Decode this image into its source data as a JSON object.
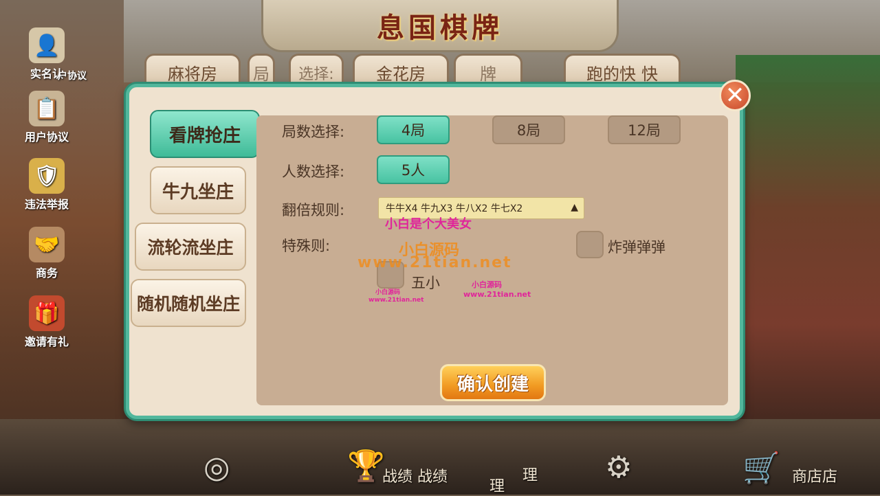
{
  "app": {
    "title": "息国棋牌"
  },
  "room_tabs": [
    "麻将房",
    "局",
    "选择:",
    "金花房",
    "牌",
    "跑的快",
    "快"
  ],
  "sidebar": [
    {
      "label": "实名认",
      "icon": "id-card-icon"
    },
    {
      "label": "户协议",
      "icon": "agreement-icon"
    },
    {
      "label": "用户协议",
      "icon": "document-icon"
    },
    {
      "label": "违法举报",
      "icon": "shield-icon"
    },
    {
      "label": "商务",
      "icon": "business-icon"
    },
    {
      "label": "邀请有礼",
      "icon": "gift-icon"
    }
  ],
  "modes": [
    "看牌抢庄",
    "牛九坐庄",
    "流轮流坐庄",
    "随机随机坐庄"
  ],
  "active_mode": "看牌抢庄",
  "rounds": {
    "label": "局数选择:",
    "options": [
      "4局",
      "8局",
      "12局"
    ],
    "selected": "4局"
  },
  "players": {
    "label": "人数选择:",
    "options": [
      "5人"
    ],
    "selected": "5人"
  },
  "multiplier": {
    "label": "翻倍规则:",
    "value": "牛牛X4 牛九X3 牛八X2 牛七X2"
  },
  "special": {
    "label": "特殊则:",
    "options": [
      "炸弹弹弹",
      "五小"
    ]
  },
  "watermarks": {
    "w1": "小白是个大美女",
    "w2": "小白源码",
    "w3": "www.21tian.net",
    "w4": "小白源码",
    "w5": "www.21tian.net",
    "w6": "小白源码",
    "w7": "www.21tian.net"
  },
  "confirm_button": "确认创建",
  "bottom_bar": {
    "record_label": "战绩 战绩",
    "manage_label": "理",
    "manage_label2": "理",
    "shop_label": "商店店"
  },
  "colors": {
    "accent": "#48c3a2",
    "confirm": "#f19a22",
    "close": "#c8472a"
  }
}
